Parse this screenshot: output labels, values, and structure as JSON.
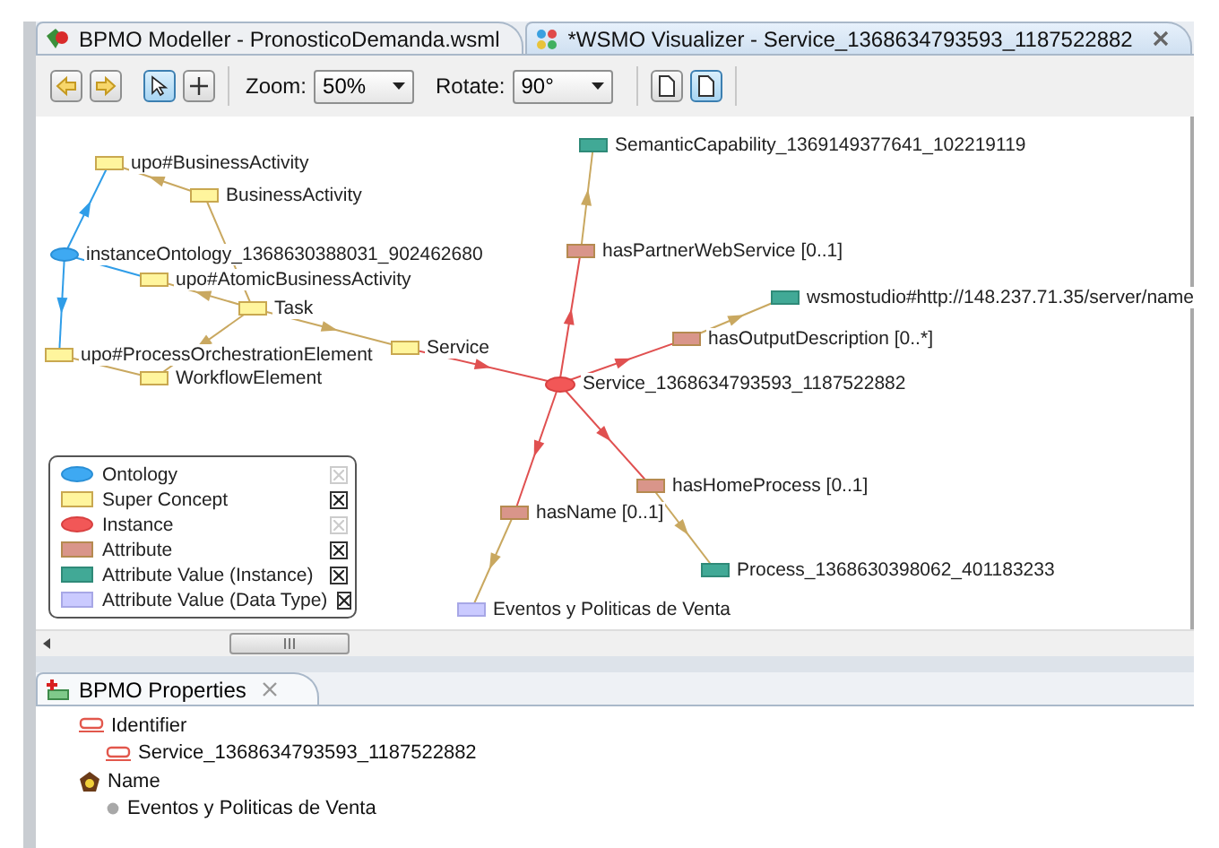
{
  "editor_tabs": [
    {
      "label": "BPMO Modeller - PronosticoDemanda.wsml",
      "selected": false,
      "closable": false
    },
    {
      "label": "*WSMO Visualizer - Service_1368634793593_1187522882",
      "selected": true,
      "closable": true
    }
  ],
  "toolbar": {
    "tools": [
      {
        "kind": "back",
        "selected": false
      },
      {
        "kind": "forward",
        "selected": false
      },
      {
        "kind": "pointer",
        "selected": true
      },
      {
        "kind": "add",
        "selected": false
      }
    ],
    "zoom": {
      "label": "Zoom:",
      "value": "50%"
    },
    "rotate": {
      "label": "Rotate:",
      "value": "90°"
    },
    "views": [
      {
        "kind": "page",
        "selected": false
      },
      {
        "kind": "page",
        "selected": true
      }
    ]
  },
  "graph": {
    "nodes": [
      {
        "kind": "value_instance",
        "label": "SemanticCapability_1369149377641_102219119"
      },
      {
        "kind": "concept",
        "label": "upo#BusinessActivity"
      },
      {
        "kind": "concept",
        "label": "BusinessActivity"
      },
      {
        "kind": "ontology",
        "label": "instanceOntology_1368630388031_902462680"
      },
      {
        "kind": "attribute",
        "label": "hasPartnerWebService [0..1]"
      },
      {
        "kind": "concept",
        "label": "upo#AtomicBusinessActivity"
      },
      {
        "kind": "concept",
        "label": "Task"
      },
      {
        "kind": "value_instance",
        "label": "wsmostudio#http://148.237.71.35/server/name"
      },
      {
        "kind": "concept",
        "label": "upo#ProcessOrchestrationElement"
      },
      {
        "kind": "concept",
        "label": "Service"
      },
      {
        "kind": "attribute",
        "label": "hasOutputDescription [0..*]"
      },
      {
        "kind": "concept",
        "label": "WorkflowElement"
      },
      {
        "kind": "instance",
        "label": "Service_1368634793593_1187522882"
      },
      {
        "kind": "attribute",
        "label": "hasHomeProcess [0..1]"
      },
      {
        "kind": "attribute",
        "label": "hasName [0..1]"
      },
      {
        "kind": "value_instance",
        "label": "Process_1368630398062_401183233"
      },
      {
        "kind": "value_datatype",
        "label": "Eventos y Politicas de Venta"
      }
    ]
  },
  "legend": [
    {
      "kind": "ontology",
      "label": "Ontology",
      "checked": true,
      "disabled": true
    },
    {
      "kind": "concept",
      "label": "Super Concept",
      "checked": true,
      "disabled": false
    },
    {
      "kind": "instance",
      "label": "Instance",
      "checked": true,
      "disabled": true
    },
    {
      "kind": "attribute",
      "label": "Attribute",
      "checked": true,
      "disabled": false
    },
    {
      "kind": "value_instance",
      "label": "Attribute Value (Instance)",
      "checked": true,
      "disabled": false
    },
    {
      "kind": "value_datatype",
      "label": "Attribute Value (Data Type)",
      "checked": true,
      "disabled": false
    }
  ],
  "properties": {
    "tab": {
      "label": "BPMO Properties",
      "closable": true
    },
    "tree": [
      {
        "kind": "identifier",
        "label": "Identifier",
        "children": [
          {
            "kind": "identifier",
            "label": "Service_1368634793593_1187522882"
          }
        ]
      },
      {
        "kind": "name",
        "label": "Name",
        "children": [
          {
            "kind": "value",
            "label": "Eventos y Politicas de Venta"
          }
        ]
      }
    ]
  }
}
